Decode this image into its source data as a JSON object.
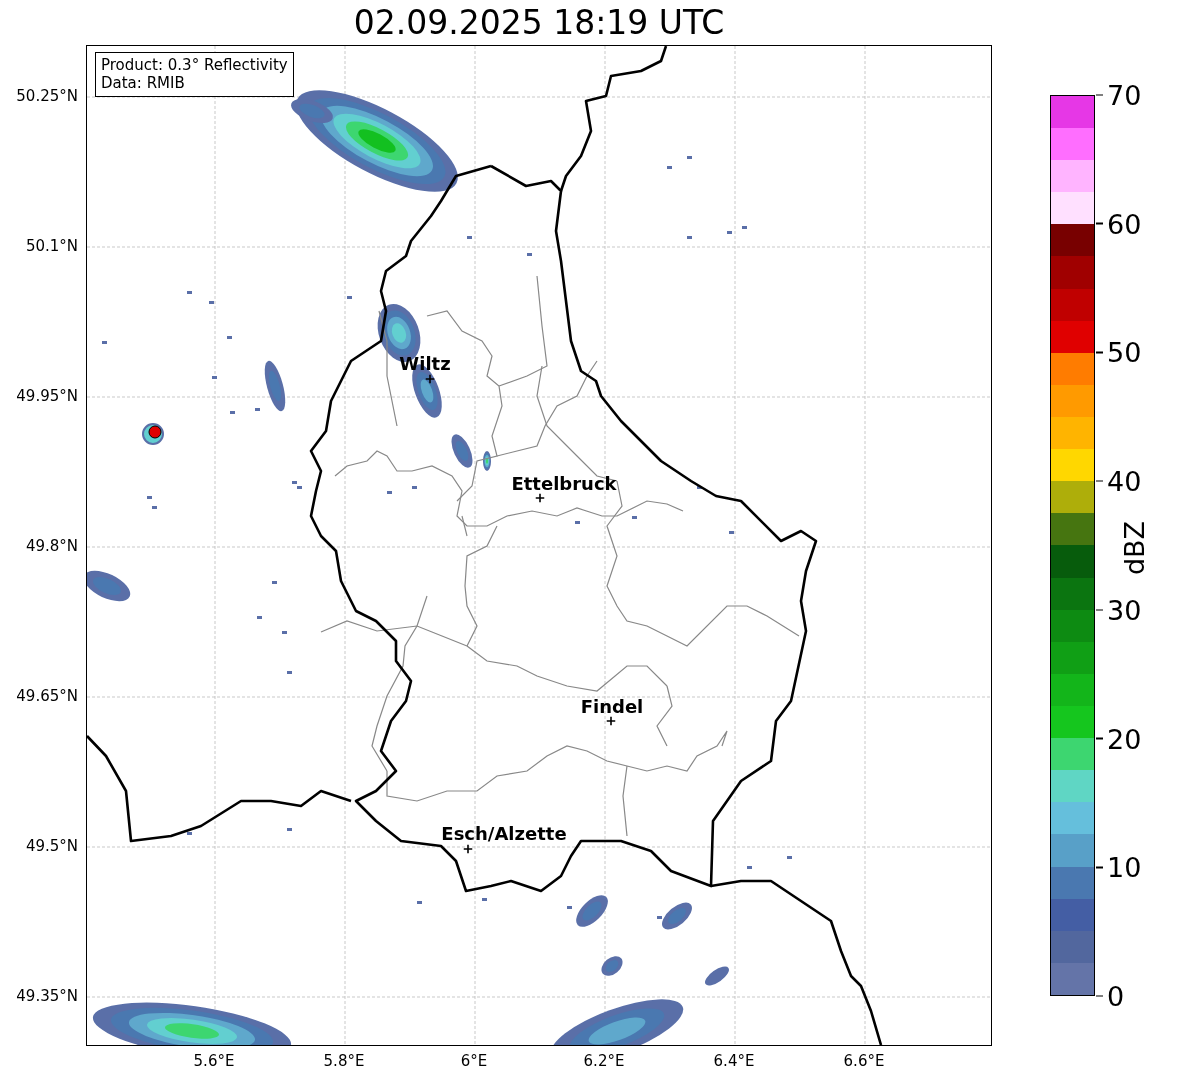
{
  "title": "02.09.2025 18:19 UTC",
  "info_box": [
    "Product: 0.3° Reflectivity",
    "Data: RMIB"
  ],
  "map": {
    "x_ticks": [
      "5.6°E",
      "5.8°E",
      "6°E",
      "6.2°E",
      "6.4°E",
      "6.6°E"
    ],
    "y_ticks": [
      "50.25°N",
      "50.1°N",
      "49.95°N",
      "49.8°N",
      "49.65°N",
      "49.5°N",
      "49.35°N"
    ],
    "places": [
      "Wiltz",
      "Ettelbruck",
      "Findel",
      "Esch/Alzette"
    ]
  },
  "colorbar": {
    "label": "dBZ",
    "ticks": [
      "70",
      "60",
      "50",
      "40",
      "30",
      "20",
      "10",
      "0"
    ],
    "bands": [
      {
        "color": "#6474a8"
      },
      {
        "color": "#52679e"
      },
      {
        "color": "#445ea4"
      },
      {
        "color": "#4a78b0"
      },
      {
        "color": "#58a0c8"
      },
      {
        "color": "#65bfdc"
      },
      {
        "color": "#5fd6c4"
      },
      {
        "color": "#3dd670"
      },
      {
        "color": "#15c61e"
      },
      {
        "color": "#13b51a"
      },
      {
        "color": "#109f15"
      },
      {
        "color": "#0d8b12"
      },
      {
        "color": "#0b7510"
      },
      {
        "color": "#075c0c"
      },
      {
        "color": "#467510"
      },
      {
        "color": "#aeae0a"
      },
      {
        "color": "#ffd700"
      },
      {
        "color": "#ffb400"
      },
      {
        "color": "#ff9a00"
      },
      {
        "color": "#ff7c00"
      },
      {
        "color": "#e00000"
      },
      {
        "color": "#c00000"
      },
      {
        "color": "#a00000"
      },
      {
        "color": "#780000"
      },
      {
        "color": "#ffe0ff"
      },
      {
        "color": "#ffb4ff"
      },
      {
        "color": "#ff6eff"
      },
      {
        "color": "#e637e6"
      }
    ]
  }
}
